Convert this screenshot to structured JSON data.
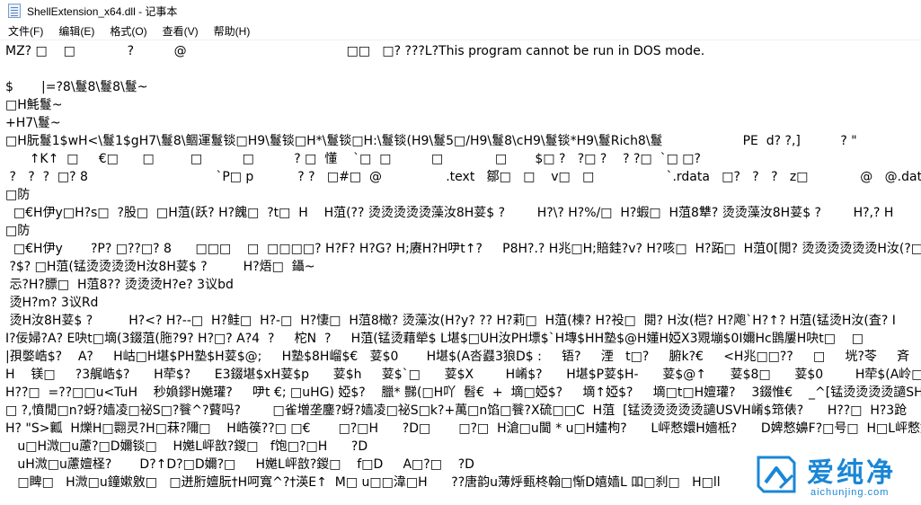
{
  "window": {
    "title": "ShellExtension_x64.dll - 记事本"
  },
  "menu": {
    "items": [
      {
        "label": "文件(F)"
      },
      {
        "label": "编辑(E)"
      },
      {
        "label": "格式(O)"
      },
      {
        "label": "查看(V)"
      },
      {
        "label": "帮助(H)"
      }
    ]
  },
  "editor": {
    "lines": [
      "MZ? □    □             ?          @                                        □□   □? ???L?This program cannot be run in DOS mode.",
      "",
      "$       |=?8\\鬘8\\鬘8\\鬘~",
      "□H魹鬘~",
      "+H7\\鬘~",
      "□H朊鬘1$wH<\\鬘1$gH7\\鬘8\\鲴運鬘锬□H9\\鬘锬□H*\\鬘锬□H:\\鬘锬(H9\\鬘5□/H9\\鬘8\\cH9\\鬘锬*H9\\鬘Rich8\\鬘                    PE  d? ?,]          ? \"",
      "      ↑K↑  □     €□      □         □          □          ? □  懂    `□  □          □             □       $□ ?   ?□ ?    ? ?□  `□ □?",
      " ?   ?  ?  □? 8                                `P□ p           ? ?   □#□  @                .text   鄒□   □    v□   □                  `.rdata   □?   ?   ?   z□             @   @.data",
      "□防",
      "  □€H伊y□H?s□  ?股□  □H菹(跃? H?餽□  ?t□  H    H菹(?? 烫烫烫烫烫藻汝8H荽$ ?        H?\\? H?%/□  H?蝦□  H菹8犨? 烫烫藻汝8H荽$ ?        H?,? H",
      "□防",
      "  □€H伊y       ?P? □??□? 8      □□□    □  □□□□? H?F? H?G? H;赓H?H吚t↑?     P8H?.? H兆□H;賠銈?v? H?咳□  H?跖□  H菹0[閲? 烫烫烫烫烫烫H汝(?□",
      " ?$? □H菹(锰烫烫烫烫H汝8H荽$ ?         H?焐□  鑷~",
      " 忈?H?膘□  H菹8?? 烫烫烫H?e? 3议bd",
      " 烫H?m? 3议Rd",
      " 烫H汝8H荽$ ?         H?<? H?--□  H?鲑□  H?-□  H?悽□  H菹8橄? 烫藻汝(H?y? ?? H?莉□  H菹(楝? H?祋□  閱? H汝(桤? H?飑`H?↑? H菹(锰烫H汝(査? I",
      "I?佞婦?A? E吷t□墑(3錣菹(胣?9? H?□? A?4  ?     柁N  ?     H菹(锰烫藉犖$ L堪$□UH汝PH墂$`H塼$HH塾$@H嬞H婭X3覭塴$0I嬭Hc鵾屢H吷t□    □",
      "|孭嫳峼$?    A?     H岵□H堪$PH塾$H荽$@;     H塾$8H嵧$€   荽$0       H堪$(A呇鼝3狼D$ :     铻?     湮   t□?     腑k?€     <H兆□□??     □     垙?苓     斉",
      "H    镁□     ?3艉峼$?      H荦$?      E3錣堪$xH荽$p      荽$h     荽$`□      荽$X        H崤$?      H堪$P荽$H-      荽$@↑      荽$8□      荽$0        H荦$(A岭□H嬔A?'  荽$",
      "H??□  =??□□u<TuH    秒媍鏐H嬔瓘?     吚t €; □uHG) 婭$?    臘* 豒(□H吖  髫€  +  墑□婭$?     墑↑婭$?     墑□t□H嬗瓘?    3錣惟€    _^[锰烫烫烫烫讁SH",
      "□ ?,憤閒□n?蚜?嫱凌□祕S□?餮^?藖吗?        □雀増垄鏖?蚜?嫱凌□祕S□k?+萬□n馅□餮?X硫□□C  H菹  [锰烫烫烫烫烫讁USVH崤$筇俵?      H??□  H?3跄",
      "H? \"S>瓤  H爍H□翾灵?H□菻?隬□    H峼篌??□ □€       □?□H      ?D□       □?□  H滄□u閫 * u□H嫿枸?      L岼慗嬛H嬙柢?      D婢慗嬶F?□号□  H□L岼慗嬛H嬙",
      "   u□H溦□u藘?□D嬭锬□    H嬔L岼敨?鍐□   f饱□?□H      ?D",
      "   uH溦□u藘嬗柽?       D?↑D?□D嬭?□     H嬔L岼敨?鍐□    f□D     A□?□    ?D",
      "   □睥□   H溦□u鐘嫰敫□   □迸胻嬗朊†H呵寬^?†渶E↑  M□ u□□湋□H      ??唐韵u薄烀甀柊翰□惭D嬉嫱L 吅□刹□   H□ll"
    ]
  },
  "watermark": {
    "text": "爱纯净",
    "url": "aichunjing.com",
    "color": "#1a86d6"
  }
}
